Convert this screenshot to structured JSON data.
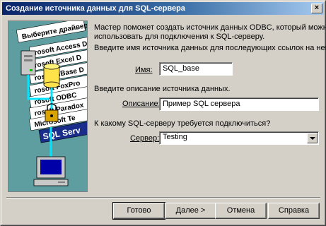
{
  "window": {
    "title": "Создание источника данных для SQL-сервера",
    "close_glyph": "×"
  },
  "illustration": {
    "tabs": [
      "Выберите драйвер",
      "rosoft Access D",
      "rosoft Excel D",
      "rosoft dBase D",
      "rosoft FoxPro",
      "rosoft ODBC",
      "rosoft Paradox",
      "Microsoft Te",
      "SQL Serv"
    ]
  },
  "intro": {
    "line1": "Мастер поможет создать источник данных ODBC, который можно",
    "line2": "использовать для подключения к SQL-серверу.",
    "prompt": "Введите имя источника данных для последующих ссылок на него."
  },
  "name_field": {
    "label": "Имя:",
    "value": "SQL_base"
  },
  "description": {
    "prompt": "Введите описание источника данных.",
    "label": "Описание:",
    "value": "Пример SQL сервера"
  },
  "server": {
    "prompt": "К какому SQL-серверу требуется подключиться?",
    "label": "Сервер:",
    "value": "Testing"
  },
  "buttons": {
    "finish": "Готово",
    "next": "Далее >",
    "cancel": "Отмена",
    "help": "Справка"
  },
  "colors": {
    "title_start": "#0a246a",
    "title_end": "#a6caf0",
    "dialog_face": "#d4d0c8",
    "illustration_bg": "#5f9ea0",
    "sql_tab": "#1a2d8a"
  }
}
